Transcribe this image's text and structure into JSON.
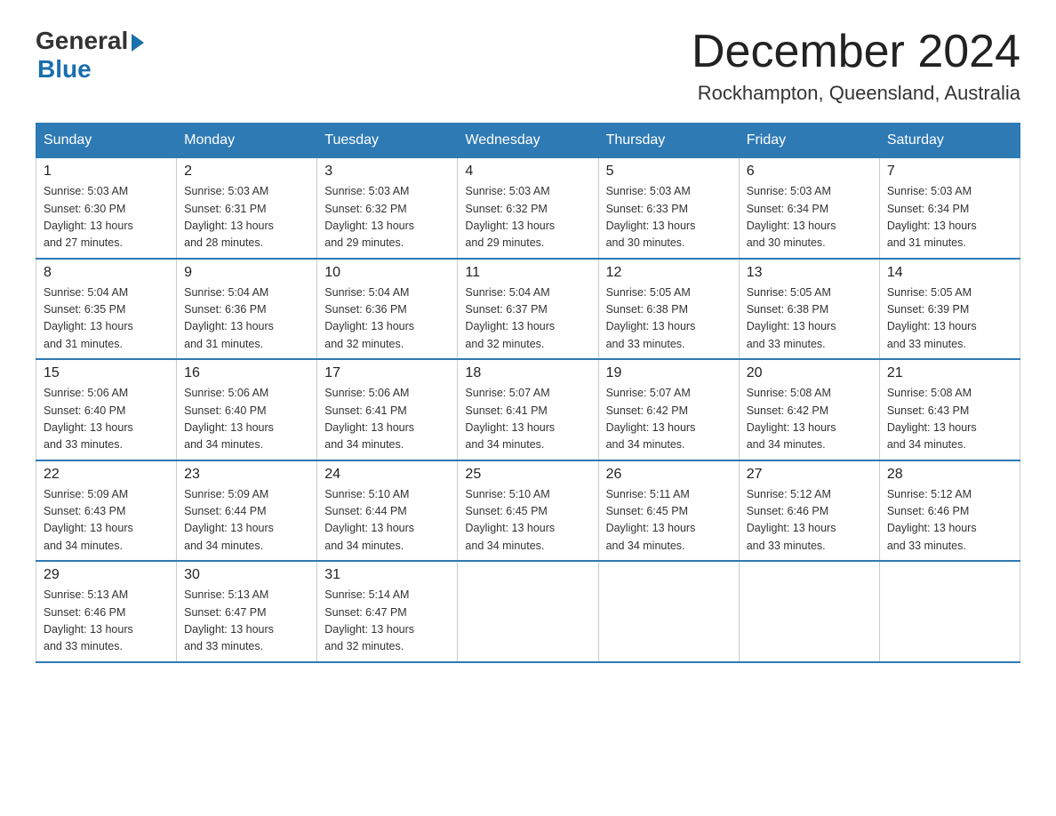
{
  "header": {
    "logo_general": "General",
    "logo_blue": "Blue",
    "month_title": "December 2024",
    "location": "Rockhampton, Queensland, Australia"
  },
  "days_of_week": [
    "Sunday",
    "Monday",
    "Tuesday",
    "Wednesday",
    "Thursday",
    "Friday",
    "Saturday"
  ],
  "weeks": [
    [
      {
        "num": "1",
        "sunrise": "5:03 AM",
        "sunset": "6:30 PM",
        "daylight": "13 hours and 27 minutes."
      },
      {
        "num": "2",
        "sunrise": "5:03 AM",
        "sunset": "6:31 PM",
        "daylight": "13 hours and 28 minutes."
      },
      {
        "num": "3",
        "sunrise": "5:03 AM",
        "sunset": "6:32 PM",
        "daylight": "13 hours and 29 minutes."
      },
      {
        "num": "4",
        "sunrise": "5:03 AM",
        "sunset": "6:32 PM",
        "daylight": "13 hours and 29 minutes."
      },
      {
        "num": "5",
        "sunrise": "5:03 AM",
        "sunset": "6:33 PM",
        "daylight": "13 hours and 30 minutes."
      },
      {
        "num": "6",
        "sunrise": "5:03 AM",
        "sunset": "6:34 PM",
        "daylight": "13 hours and 30 minutes."
      },
      {
        "num": "7",
        "sunrise": "5:03 AM",
        "sunset": "6:34 PM",
        "daylight": "13 hours and 31 minutes."
      }
    ],
    [
      {
        "num": "8",
        "sunrise": "5:04 AM",
        "sunset": "6:35 PM",
        "daylight": "13 hours and 31 minutes."
      },
      {
        "num": "9",
        "sunrise": "5:04 AM",
        "sunset": "6:36 PM",
        "daylight": "13 hours and 31 minutes."
      },
      {
        "num": "10",
        "sunrise": "5:04 AM",
        "sunset": "6:36 PM",
        "daylight": "13 hours and 32 minutes."
      },
      {
        "num": "11",
        "sunrise": "5:04 AM",
        "sunset": "6:37 PM",
        "daylight": "13 hours and 32 minutes."
      },
      {
        "num": "12",
        "sunrise": "5:05 AM",
        "sunset": "6:38 PM",
        "daylight": "13 hours and 33 minutes."
      },
      {
        "num": "13",
        "sunrise": "5:05 AM",
        "sunset": "6:38 PM",
        "daylight": "13 hours and 33 minutes."
      },
      {
        "num": "14",
        "sunrise": "5:05 AM",
        "sunset": "6:39 PM",
        "daylight": "13 hours and 33 minutes."
      }
    ],
    [
      {
        "num": "15",
        "sunrise": "5:06 AM",
        "sunset": "6:40 PM",
        "daylight": "13 hours and 33 minutes."
      },
      {
        "num": "16",
        "sunrise": "5:06 AM",
        "sunset": "6:40 PM",
        "daylight": "13 hours and 34 minutes."
      },
      {
        "num": "17",
        "sunrise": "5:06 AM",
        "sunset": "6:41 PM",
        "daylight": "13 hours and 34 minutes."
      },
      {
        "num": "18",
        "sunrise": "5:07 AM",
        "sunset": "6:41 PM",
        "daylight": "13 hours and 34 minutes."
      },
      {
        "num": "19",
        "sunrise": "5:07 AM",
        "sunset": "6:42 PM",
        "daylight": "13 hours and 34 minutes."
      },
      {
        "num": "20",
        "sunrise": "5:08 AM",
        "sunset": "6:42 PM",
        "daylight": "13 hours and 34 minutes."
      },
      {
        "num": "21",
        "sunrise": "5:08 AM",
        "sunset": "6:43 PM",
        "daylight": "13 hours and 34 minutes."
      }
    ],
    [
      {
        "num": "22",
        "sunrise": "5:09 AM",
        "sunset": "6:43 PM",
        "daylight": "13 hours and 34 minutes."
      },
      {
        "num": "23",
        "sunrise": "5:09 AM",
        "sunset": "6:44 PM",
        "daylight": "13 hours and 34 minutes."
      },
      {
        "num": "24",
        "sunrise": "5:10 AM",
        "sunset": "6:44 PM",
        "daylight": "13 hours and 34 minutes."
      },
      {
        "num": "25",
        "sunrise": "5:10 AM",
        "sunset": "6:45 PM",
        "daylight": "13 hours and 34 minutes."
      },
      {
        "num": "26",
        "sunrise": "5:11 AM",
        "sunset": "6:45 PM",
        "daylight": "13 hours and 34 minutes."
      },
      {
        "num": "27",
        "sunrise": "5:12 AM",
        "sunset": "6:46 PM",
        "daylight": "13 hours and 33 minutes."
      },
      {
        "num": "28",
        "sunrise": "5:12 AM",
        "sunset": "6:46 PM",
        "daylight": "13 hours and 33 minutes."
      }
    ],
    [
      {
        "num": "29",
        "sunrise": "5:13 AM",
        "sunset": "6:46 PM",
        "daylight": "13 hours and 33 minutes."
      },
      {
        "num": "30",
        "sunrise": "5:13 AM",
        "sunset": "6:47 PM",
        "daylight": "13 hours and 33 minutes."
      },
      {
        "num": "31",
        "sunrise": "5:14 AM",
        "sunset": "6:47 PM",
        "daylight": "13 hours and 32 minutes."
      },
      null,
      null,
      null,
      null
    ]
  ],
  "labels": {
    "sunrise": "Sunrise:",
    "sunset": "Sunset:",
    "daylight": "Daylight:"
  }
}
